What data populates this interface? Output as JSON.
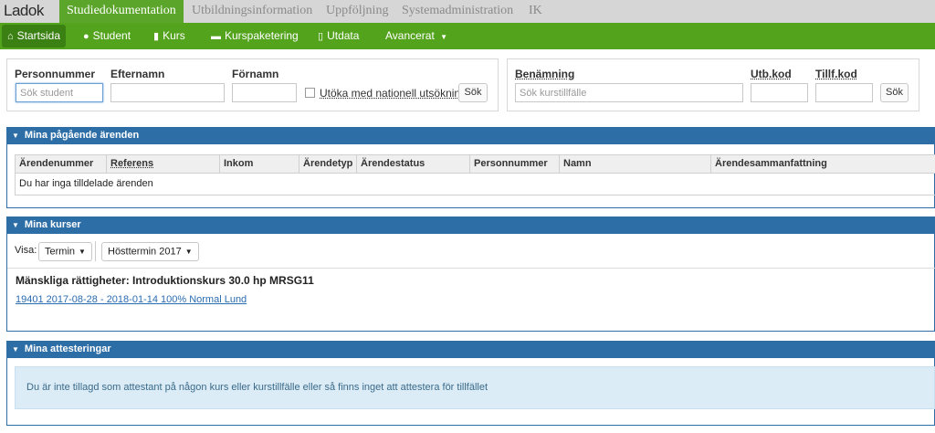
{
  "top_nav": {
    "logo": "Ladok",
    "items": [
      "Studiedokumentation",
      "Utbildningsinformation",
      "Uppföljning",
      "Systemadministration",
      "IK"
    ]
  },
  "main_nav": {
    "items": [
      {
        "label": "Startsida",
        "icon": "home-icon"
      },
      {
        "label": "Student",
        "icon": "user-icon"
      },
      {
        "label": "Kurs",
        "icon": "book-icon"
      },
      {
        "label": "Kurspaketering",
        "icon": "folder-icon"
      },
      {
        "label": "Utdata",
        "icon": "file-icon"
      },
      {
        "label": "Avancerat",
        "icon": "caret-down-icon"
      }
    ]
  },
  "student_search": {
    "personnummer_label": "Personnummer",
    "efternamn_label": "Efternamn",
    "fornamn_label": "Förnamn",
    "personnummer_placeholder": "Sök student",
    "efternamn_value": "",
    "fornamn_value": "",
    "national_search_label": "Utöka med nationell utsökning",
    "national_search_checked": false,
    "search_button": "Sök"
  },
  "course_search": {
    "benamning_label": "Benämning",
    "utbkod_label": "Utb.kod",
    "tillfkod_label": "Tillf.kod",
    "benamning_placeholder": "Sök kurstillfälle",
    "search_button": "Sök"
  },
  "arenden": {
    "title": "Mina pågående ärenden",
    "columns": [
      "Ärendenummer",
      "Referens",
      "Inkom",
      "Ärendetyp",
      "Ärendestatus",
      "Personnummer",
      "Namn",
      "Ärendesammanfattning"
    ],
    "empty_text": "Du har inga tilldelade ärenden"
  },
  "kurser": {
    "title": "Mina kurser",
    "visa_label": "Visa:",
    "filter_type": "Termin",
    "filter_term": "Hösttermin 2017",
    "course_title": "Mänskliga rättigheter: Introduktionskurs 30.0 hp MRSG11",
    "course_link": "19401 2017-08-28 - 2018-01-14 100% Normal Lund"
  },
  "attesteringar": {
    "title": "Mina attesteringar",
    "info_text": "Du är inte tillagd som attestant på någon kurs eller kurstillfälle eller så finns inget att attestera för tillfället"
  },
  "colors": {
    "brand_green": "#54a31d",
    "active_green": "#3b8012",
    "section_blue": "#2e6ea6",
    "info_bg": "#dbecf6"
  }
}
